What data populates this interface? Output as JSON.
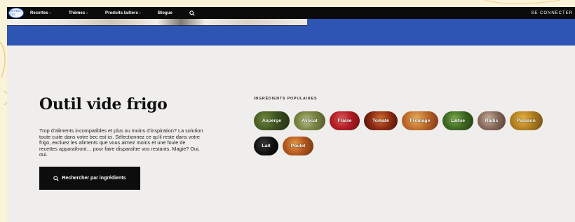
{
  "nav": {
    "logo_text": "Recettes d'ici",
    "items": [
      {
        "label": "Recettes",
        "chevron": "›"
      },
      {
        "label": "Thèmes",
        "chevron": "›"
      },
      {
        "label": "Produits laitiers",
        "chevron": "›"
      },
      {
        "label": "Blogue",
        "chevron": ""
      }
    ],
    "search_icon": "search-icon",
    "login_label": "SE CONNECTER"
  },
  "main": {
    "title": "Outil vide frigo",
    "description": "Trop d'aliments incompatibles et plus ou moins d'inspiration? La solution toute cuite dans votre bec est ici. Sélectionnez ce qu'il reste dans votre frigo, excluez les aliments que vous aimez moins et une foule de recettes apparaîtront… pour faire disparaître vos restants. Magie? Oui, oui.",
    "search_button_label": "Rechercher par ingrédients"
  },
  "ingredients": {
    "heading": "INGRÉDIENTS POPULAIRES",
    "items": [
      "Asperge",
      "Avocat",
      "Fraise",
      "Tomate",
      "Fromage",
      "Laitue",
      "Radis",
      "Poisson",
      "Lait",
      "Poulet"
    ]
  },
  "colors": {
    "nav_bg": "#0b0b0b",
    "hero_blue": "#2f55b4",
    "page_bg": "#efeeec",
    "button_bg": "#0d0d0d"
  }
}
